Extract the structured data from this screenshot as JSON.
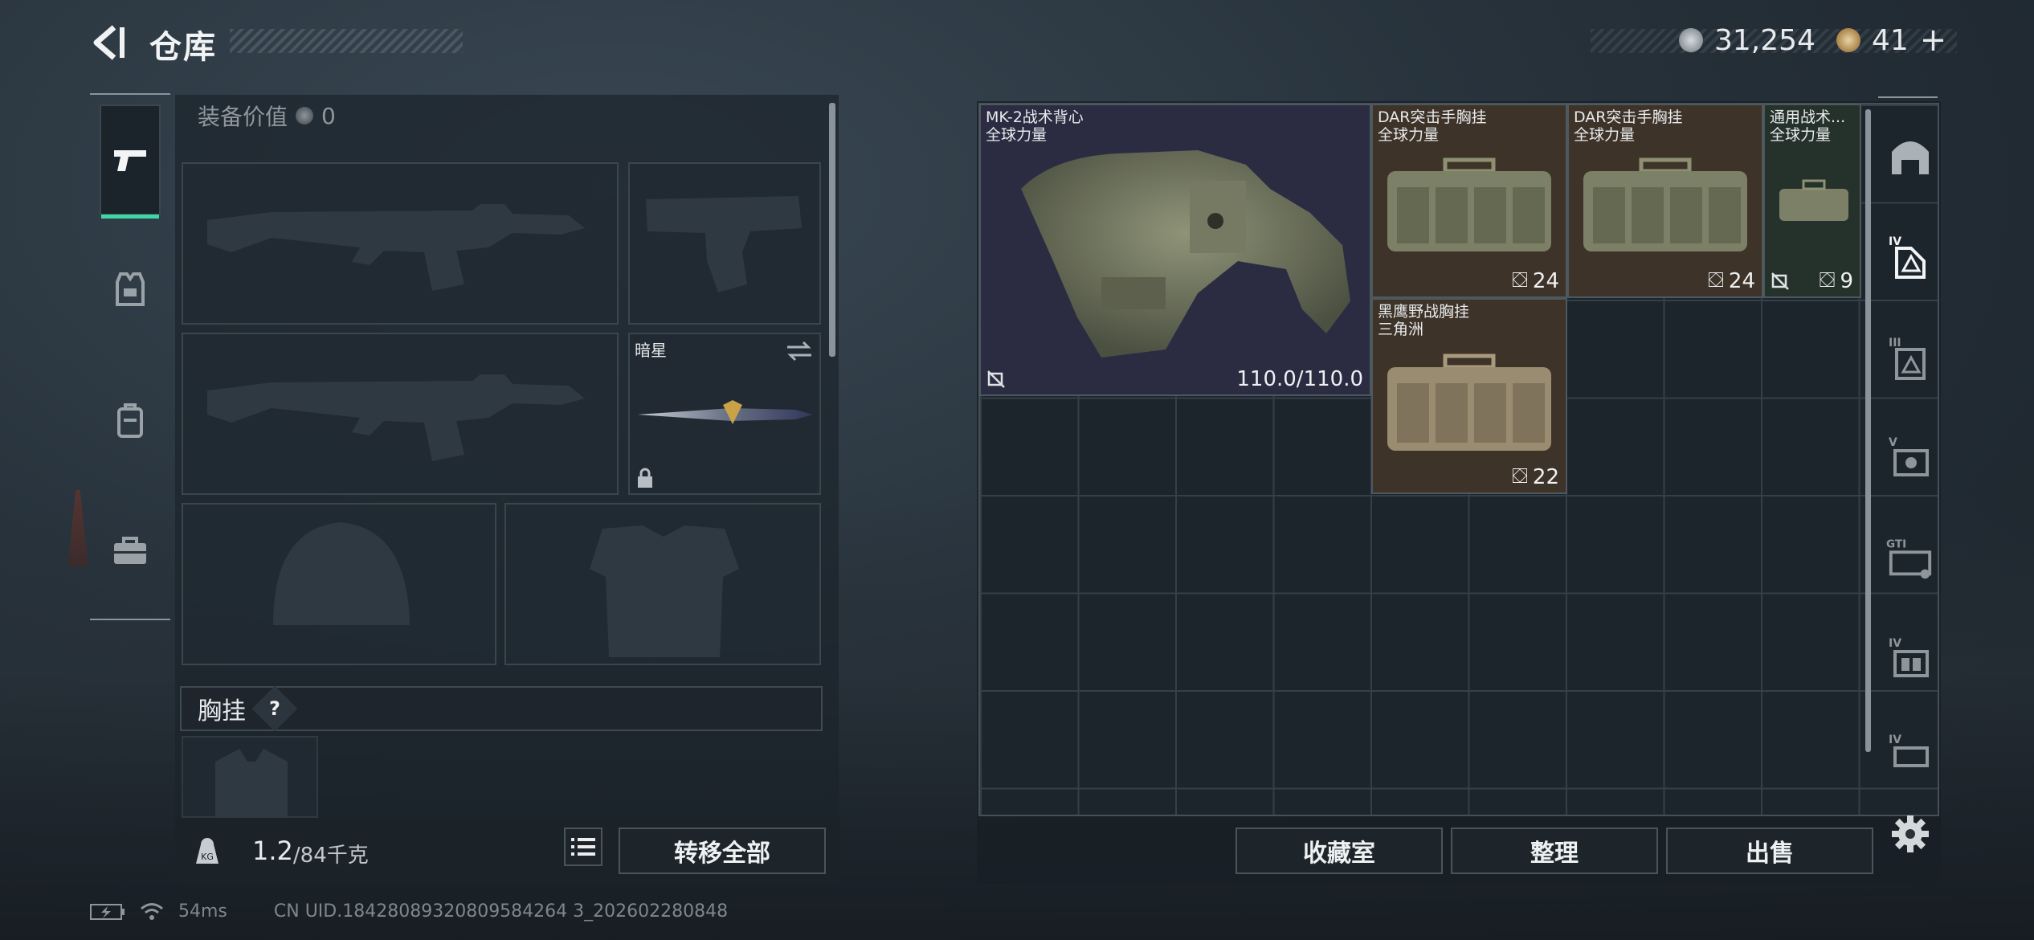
{
  "header": {
    "title": "仓库",
    "currency1": "31,254",
    "currency2": "41",
    "plus_label": "+"
  },
  "left_tabs": [
    {
      "name": "weapons",
      "icon": "pistol-icon",
      "active": true
    },
    {
      "name": "armor",
      "icon": "vest-icon",
      "active": false
    },
    {
      "name": "backpack",
      "icon": "backpack-icon",
      "active": false
    },
    {
      "name": "tools",
      "icon": "toolbox-icon",
      "active": false
    }
  ],
  "equipment": {
    "value_label": "装备价值",
    "value": "0",
    "melee_name": "暗星",
    "section_label": "胸挂",
    "help_label": "?"
  },
  "footer": {
    "weight_current": "1.2",
    "weight_max": "/84千克",
    "transfer_all": "转移全部"
  },
  "items": [
    {
      "name": "MK-2战术背心",
      "origin": "全球力量",
      "durability": "110.0/110.0"
    },
    {
      "name": "DAR突击手胸挂",
      "origin": "全球力量",
      "count": "24"
    },
    {
      "name": "DAR突击手胸挂",
      "origin": "全球力量",
      "count": "24"
    },
    {
      "name": "通用战术...",
      "origin": "全球力量",
      "count": "9"
    },
    {
      "name": "黑鹰野战胸挂",
      "origin": "三角洲",
      "count": "22"
    }
  ],
  "right_buttons": {
    "collection": "收藏室",
    "sort": "整理",
    "sell": "出售"
  },
  "right_tabs": [
    "storage-icon",
    "tier-iv-vest-icon",
    "tier-iii-vest-icon",
    "tier-v-helmet-icon",
    "gti-case-icon",
    "tier-iv-rig-icon",
    "tier-iv-armor-icon"
  ],
  "status": {
    "ping": "54ms",
    "uid": "CN UID.18428089320809584264 3_202602280848"
  },
  "colors": {
    "accent": "#3fd7a5",
    "item_purple": "#2b2c42",
    "item_brown": "#3e3329",
    "item_green": "#25322b"
  }
}
